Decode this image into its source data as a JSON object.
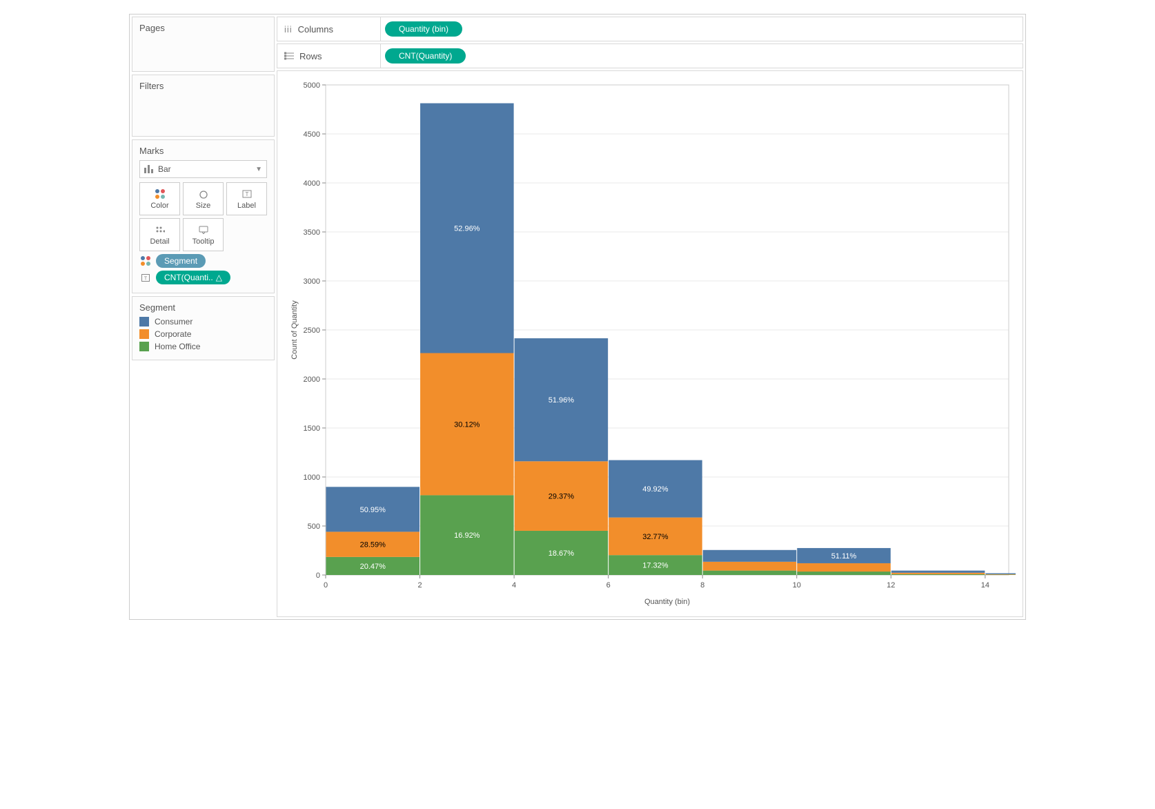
{
  "pages_label": "Pages",
  "filters_label": "Filters",
  "marks_label": "Marks",
  "mark_type": "Bar",
  "mark_buttons": {
    "color": "Color",
    "size": "Size",
    "label": "Label",
    "detail": "Detail",
    "tooltip": "Tooltip"
  },
  "marks_pills": {
    "segment": "Segment",
    "cnt": "CNT(Quanti.."
  },
  "legend_title": "Segment",
  "legend_items": [
    {
      "label": "Consumer",
      "color": "#4e79a7"
    },
    {
      "label": "Corporate",
      "color": "#f28e2b"
    },
    {
      "label": "Home Office",
      "color": "#59a14f"
    }
  ],
  "columns_label": "Columns",
  "rows_label": "Rows",
  "columns_pill": "Quantity (bin)",
  "rows_pill": "CNT(Quantity)",
  "chart_data": {
    "type": "bar",
    "stacked": true,
    "xlabel": "Quantity (bin)",
    "ylabel": "Count of Quantity",
    "ylim": [
      0,
      5000
    ],
    "yticks": [
      0,
      500,
      1000,
      1500,
      2000,
      2500,
      3000,
      3500,
      4000,
      4500,
      5000
    ],
    "xticks": [
      0,
      2,
      4,
      6,
      8,
      10,
      12,
      14
    ],
    "categories": [
      0,
      2,
      4,
      6,
      8,
      10,
      12,
      14
    ],
    "series": [
      {
        "name": "Home Office",
        "color": "#59a14f",
        "values": [
          184,
          814,
          451,
          203,
          45,
          35,
          8,
          3
        ]
      },
      {
        "name": "Corporate",
        "color": "#f28e2b",
        "values": [
          257,
          1450,
          709,
          384,
          90,
          85,
          15,
          5
        ]
      },
      {
        "name": "Consumer",
        "color": "#4e79a7",
        "values": [
          458,
          2549,
          1255,
          585,
          120,
          155,
          22,
          10
        ]
      }
    ],
    "percent_labels": [
      {
        "cat": 0,
        "seg": "Home Office",
        "text": "20.47%"
      },
      {
        "cat": 0,
        "seg": "Corporate",
        "text": "28.59%"
      },
      {
        "cat": 0,
        "seg": "Consumer",
        "text": "50.95%"
      },
      {
        "cat": 2,
        "seg": "Home Office",
        "text": "16.92%"
      },
      {
        "cat": 2,
        "seg": "Corporate",
        "text": "30.12%"
      },
      {
        "cat": 2,
        "seg": "Consumer",
        "text": "52.96%"
      },
      {
        "cat": 4,
        "seg": "Home Office",
        "text": "18.67%"
      },
      {
        "cat": 4,
        "seg": "Corporate",
        "text": "29.37%"
      },
      {
        "cat": 4,
        "seg": "Consumer",
        "text": "51.96%"
      },
      {
        "cat": 6,
        "seg": "Home Office",
        "text": "17.32%"
      },
      {
        "cat": 6,
        "seg": "Corporate",
        "text": "32.77%"
      },
      {
        "cat": 6,
        "seg": "Consumer",
        "text": "49.92%"
      },
      {
        "cat": 10,
        "seg": "Consumer",
        "text": "51.11%"
      }
    ]
  }
}
